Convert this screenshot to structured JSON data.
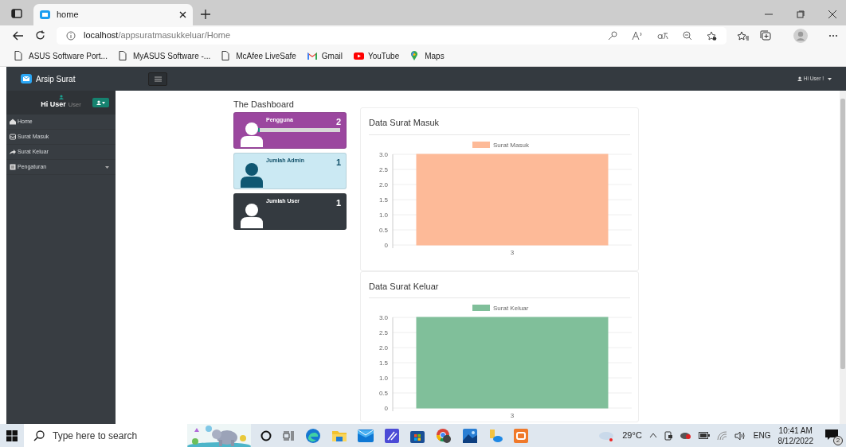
{
  "browser": {
    "tab_title": "home",
    "url_host": "localhost",
    "url_path": "/appsuratmasukkeluar/Home",
    "bookmarks": [
      {
        "label": "ASUS Software Port...",
        "kind": "page"
      },
      {
        "label": "MyASUS Software -...",
        "kind": "page"
      },
      {
        "label": "McAfee LiveSafe",
        "kind": "page"
      },
      {
        "label": "Gmail",
        "kind": "mail"
      },
      {
        "label": "YouTube",
        "kind": "video"
      },
      {
        "label": "Maps",
        "kind": "pin"
      }
    ]
  },
  "navbar": {
    "brand": "Arsip Surat",
    "user_menu": "Hi User !"
  },
  "sidebar": {
    "greeting": "Hi User",
    "role": "User",
    "items": [
      {
        "label": "Home",
        "kind": "home",
        "expandable": false
      },
      {
        "label": "Surat Masuk",
        "kind": "inbox",
        "expandable": false
      },
      {
        "label": "Surat Keluar",
        "kind": "share",
        "expandable": false
      },
      {
        "label": "Pengaturan",
        "kind": "settings",
        "expandable": true
      }
    ]
  },
  "dashboard": {
    "title": "The Dashboard",
    "stats": [
      {
        "label": "Pengguna",
        "value": "2",
        "kind": "purple",
        "level": 0.02
      },
      {
        "label": "Jumlah Admin",
        "value": "1",
        "kind": "info"
      },
      {
        "label": "Jumlah User",
        "value": "1",
        "kind": "dark"
      }
    ]
  },
  "charts": [
    {
      "title": "Data Surat Masuk",
      "chart_data": {
        "type": "bar",
        "grid": true,
        "categories": [
          "3"
        ],
        "series": [
          {
            "name": "Surat Masuk",
            "color": "#fdba98",
            "values": [
              3
            ]
          }
        ],
        "ylim": [
          0,
          3
        ],
        "yticks": [
          {
            "value": 0,
            "label": "0"
          },
          {
            "value": 0.5,
            "label": "0.5"
          },
          {
            "value": 1,
            "label": "1.0"
          },
          {
            "value": 1.5,
            "label": "1.5"
          },
          {
            "value": 2,
            "label": "2.0"
          },
          {
            "value": 2.5,
            "label": "2.5"
          },
          {
            "value": 3,
            "label": "3.0"
          }
        ]
      }
    },
    {
      "title": "Data Surat Keluar",
      "chart_data": {
        "type": "bar",
        "grid": true,
        "categories": [
          "3"
        ],
        "series": [
          {
            "name": "Surat Keluar",
            "color": "#80bf9a",
            "values": [
              3
            ]
          }
        ],
        "ylim": [
          0,
          3
        ],
        "yticks": [
          {
            "value": 0,
            "label": "0"
          },
          {
            "value": 0.5,
            "label": "0.5"
          },
          {
            "value": 1,
            "label": "1.0"
          },
          {
            "value": 1.5,
            "label": "1.5"
          },
          {
            "value": 2,
            "label": "2.0"
          },
          {
            "value": 2.5,
            "label": "2.5"
          },
          {
            "value": 3,
            "label": "3.0"
          }
        ]
      }
    }
  ],
  "taskbar": {
    "search_placeholder": "Type here to search",
    "weather": "29°C",
    "language": "ENG",
    "time": "10:41 AM",
    "date": "8/12/2022",
    "notifications": "2"
  }
}
